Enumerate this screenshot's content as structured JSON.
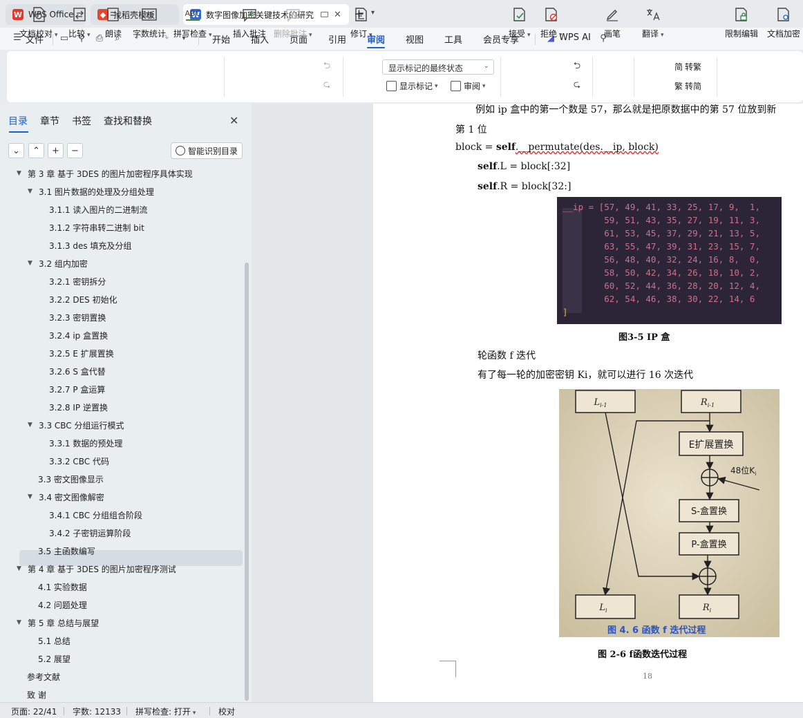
{
  "tabs": [
    {
      "label": "WPS Office"
    },
    {
      "label": "找稻壳模板"
    },
    {
      "label": "数字图像加密关键技术的研究"
    }
  ],
  "menu": {
    "file": "文件",
    "items": [
      "开始",
      "插入",
      "页面",
      "引用",
      "审阅",
      "视图",
      "工具",
      "会员专享"
    ],
    "active": "审阅",
    "wps_ai": "WPS AI"
  },
  "ribbon": {
    "doc_check": "文档校对",
    "compare": "比较",
    "read_aloud": "朗读",
    "word_count": "字数统计",
    "spell_check": "拼写检查",
    "abc": "ABC",
    "count_icon": "12",
    "insert_comment": "插入批注",
    "delete_comment": "删除批注",
    "revise": "修订",
    "markup_select": "显示标记的最终状态",
    "show_markup": "显示标记",
    "review": "审阅",
    "accept": "接受",
    "reject": "拒绝",
    "pen": "画笔",
    "translate": "翻译",
    "to_simplified": "繁转简",
    "simp_to_trad": "转繁",
    "trad_to_simp": "转简",
    "restrict_edit": "限制编辑",
    "doc_encrypt": "文档加密"
  },
  "sidepane": {
    "tabs": [
      "目录",
      "章节",
      "书签",
      "查找和替换"
    ],
    "smart_button": "智能识别目录",
    "toc": [
      {
        "text": "第 3 章  基于 3DES 的图片加密程序具体实现",
        "level": 1,
        "arrow": true
      },
      {
        "text": "3.1 图片数据的处理及分组处理",
        "level": 2,
        "arrow": true
      },
      {
        "text": "3.1.1 读入图片的二进制流",
        "level": 3
      },
      {
        "text": "3.1.2 字符串转二进制 bit",
        "level": 3
      },
      {
        "text": "3.1.3 des 填充及分组",
        "level": 3
      },
      {
        "text": "3.2  组内加密",
        "level": 2,
        "arrow": true
      },
      {
        "text": "3.2.1  密钥拆分",
        "level": 3
      },
      {
        "text": "3.2.2 DES 初始化",
        "level": 3
      },
      {
        "text": "3.2.3  密钥置换",
        "level": 3
      },
      {
        "text": "3.2.4 ip 盒置换",
        "level": 3
      },
      {
        "text": "3.2.5 E 扩展置换",
        "level": 3
      },
      {
        "text": "3.2.6 S 盒代替",
        "level": 3
      },
      {
        "text": "3.2.7 P 盒运算",
        "level": 3
      },
      {
        "text": "3.2.8 IP 逆置换",
        "level": 3
      },
      {
        "text": "3.3 CBC 分组运行模式",
        "level": 2,
        "arrow": true
      },
      {
        "text": "3.3.1  数据的预处理",
        "level": 3
      },
      {
        "text": "3.3.2 CBC 代码",
        "level": 3
      },
      {
        "text": "3.3  密文图像显示",
        "level": 2
      },
      {
        "text": "3.4  密文图像解密",
        "level": 2,
        "arrow": true
      },
      {
        "text": "3.4.1 CBC 分组组合阶段",
        "level": 3
      },
      {
        "text": "3.4.2  子密钥运算阶段",
        "level": 3
      },
      {
        "text": "3.5  主函数编写",
        "level": 2
      },
      {
        "text": "第 4 章  基于 3DES 的图片加密程序测试",
        "level": 1,
        "arrow": true
      },
      {
        "text": "4.1 实验数据",
        "level": 2
      },
      {
        "text": "4.2 问题处理",
        "level": 2
      },
      {
        "text": "第 5 章  总结与展望",
        "level": 1,
        "arrow": true
      },
      {
        "text": "5.1  总结",
        "level": 2
      },
      {
        "text": "5.2  展望",
        "level": 2
      },
      {
        "text": "参考文献",
        "level": 1
      },
      {
        "text": "致    谢",
        "level": 1
      }
    ],
    "selected_index": 18
  },
  "document": {
    "line1": "例如 ip 盒中的第一个数是 57，那么就是把原数据中的第 57 位放到新",
    "line2": "第 1 位",
    "code_block_prefix": "block = ",
    "code_block_self": "self",
    "code_block_rest": ".__permutate(des.__ip, block)",
    "code_L_self": "self",
    "code_L_rest": ".L = block[:32]",
    "code_R_self": "self",
    "code_R_rest": ".R = block[32:]",
    "code_lines": [
      "__ip = [57, 49, 41, 33, 25, 17, 9,  1,",
      "        59, 51, 43, 35, 27, 19, 11, 3,",
      "        61, 53, 45, 37, 29, 21, 13, 5,",
      "        63, 55, 47, 39, 31, 23, 15, 7,",
      "        56, 48, 40, 32, 24, 16, 8,  0,",
      "        58, 50, 42, 34, 26, 18, 10, 2,",
      "        60, 52, 44, 36, 28, 20, 12, 4,",
      "        62, 54, 46, 38, 30, 22, 14, 6",
      "]"
    ],
    "caption1": "图3-5    IP 盒",
    "para1": "轮函数 f 迭代",
    "para2": "有了每一轮的加密密钥 Ki，就可以进行 16 次迭代",
    "figure": {
      "L_prev": "L",
      "L_prev_sub": "i-1",
      "R_prev": "R",
      "R_prev_sub": "i-1",
      "e_box": "E扩展置换",
      "key": "48位K",
      "key_sub": "i",
      "s_box": "S-盒置换",
      "p_box": "P-盒置换",
      "L_next": "L",
      "L_next_sub": "i",
      "R_next": "R",
      "R_next_sub": "i",
      "photo_caption": "图 4. 6    函数 f 迭代过程"
    },
    "caption2": "图 2-6    f函数迭代过程",
    "page_number": "18"
  },
  "status": {
    "page": "页面: 22/41",
    "words": "字数: 12133",
    "spell": "拼写检查: 打开",
    "proof": "校对"
  },
  "colors": {
    "accent": "#1a5fd6",
    "wps_red": "#e8362d",
    "code_bg": "#2b2537",
    "code_text": "#cf6f8a"
  }
}
